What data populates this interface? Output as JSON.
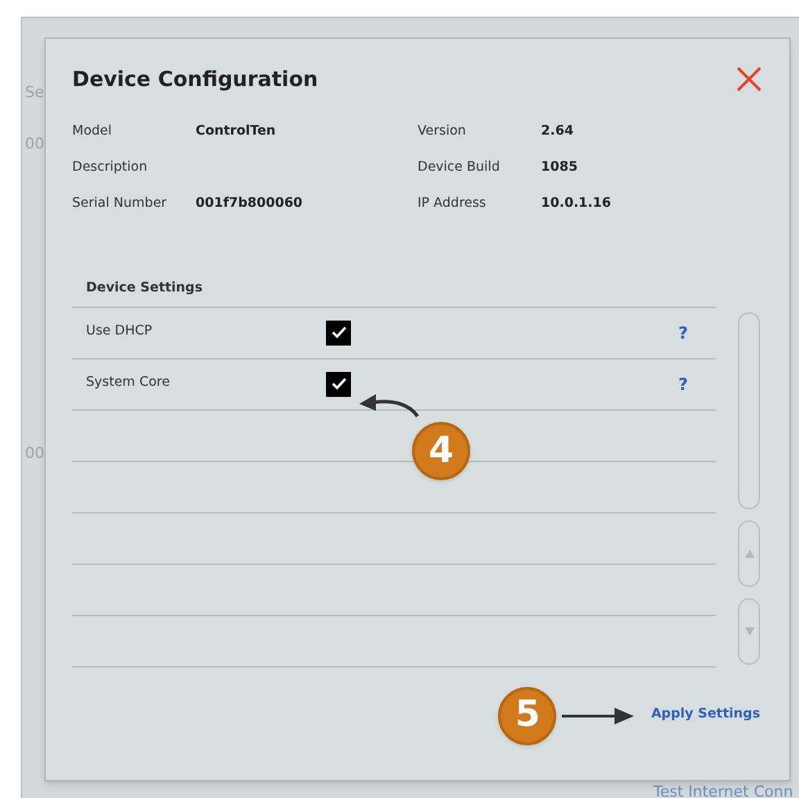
{
  "background_fragments": [
    "Se",
    "00",
    "00",
    "Test Internet Conn"
  ],
  "dialog": {
    "title": "Device Configuration",
    "info": [
      {
        "label": "Model",
        "value": "ControlTen"
      },
      {
        "label": "Version",
        "value": "2.64"
      },
      {
        "label": "Description"
      },
      {
        "label": "Device Build",
        "value": "1085"
      },
      {
        "label": "Serial Number",
        "value": "001f7b800060"
      },
      {
        "label": "IP Address",
        "value": "10.0.1.16"
      }
    ],
    "settings_title": "Device Settings",
    "settings": [
      {
        "label": "Use DHCP",
        "checked": true,
        "help": "?"
      },
      {
        "label": "System Core",
        "checked": true,
        "help": "?"
      }
    ],
    "apply_label": "Apply Settings"
  },
  "callouts": [
    {
      "number": "4"
    },
    {
      "number": "5"
    }
  ]
}
